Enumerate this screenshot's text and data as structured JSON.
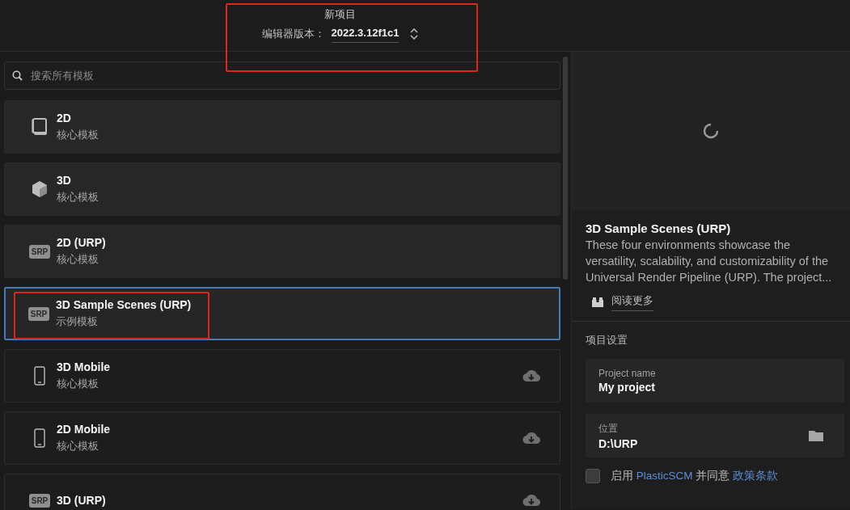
{
  "header": {
    "title": "新项目",
    "version_label": "编辑器版本：",
    "version": "2022.3.12f1c1"
  },
  "search": {
    "placeholder": "搜索所有模板"
  },
  "templates": [
    {
      "name": "2D",
      "category": "核心模板",
      "kind": "book",
      "selected": false,
      "download": false
    },
    {
      "name": "3D",
      "category": "核心模板",
      "kind": "cube",
      "selected": false,
      "download": false
    },
    {
      "name": "2D (URP)",
      "category": "核心模板",
      "kind": "badge",
      "badge": "SRP",
      "selected": false,
      "download": false
    },
    {
      "name": "3D Sample Scenes (URP)",
      "category": "示例模板",
      "kind": "badge",
      "badge": "SRP",
      "selected": true,
      "download": false
    },
    {
      "name": "3D Mobile",
      "category": "核心模板",
      "kind": "phone",
      "selected": false,
      "download": true
    },
    {
      "name": "2D Mobile",
      "category": "核心模板",
      "kind": "phone",
      "selected": false,
      "download": true
    },
    {
      "name": "3D (URP)",
      "kind": "badge",
      "badge": "SRP",
      "selected": false,
      "download": true
    }
  ],
  "details": {
    "title": "3D Sample Scenes (URP)",
    "description": "These four environments showcase the versatility, scalability, and customizability of the Universal Render Pipeline (URP). The project...",
    "read_more": "阅读更多"
  },
  "settings": {
    "heading": "项目设置",
    "fields": [
      {
        "label": "Project name",
        "value": "My project",
        "kind": "text"
      },
      {
        "label": "位置",
        "value": "D:\\URP",
        "kind": "folder"
      }
    ]
  },
  "consent": {
    "checked": false,
    "prefix": "启用",
    "link": "PlasticSCM",
    "middle": "并同意",
    "policy_link": "政策条款"
  }
}
